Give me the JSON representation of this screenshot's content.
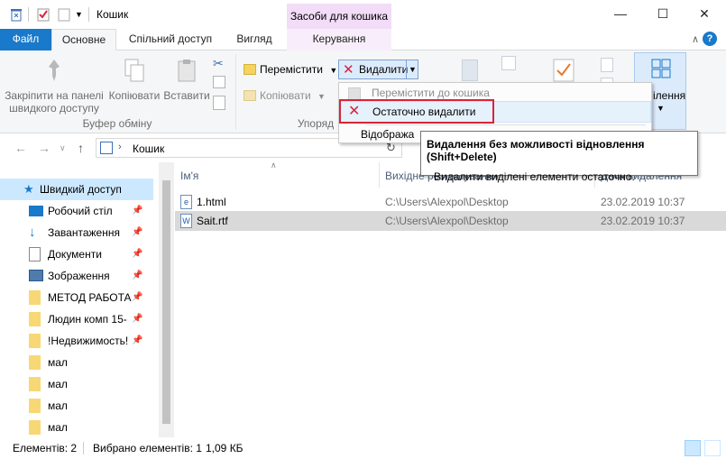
{
  "window": {
    "title": "Кошик",
    "context_tab_header": "Засоби для кошика",
    "minimize": "—",
    "maximize": "☐",
    "close": "✕"
  },
  "ribbon": {
    "tabs": [
      "Файл",
      "Основне",
      "Спільний доступ",
      "Вигляд",
      "Керування"
    ],
    "clipboard": {
      "pin_label": "Закріпити на панелі швидкого доступу",
      "copy_label": "Копіювати",
      "paste_label": "Вставити",
      "group_label": "Буфер обміну"
    },
    "organize": {
      "move_label": "Перемістити",
      "copy_to_label": "Копіювати",
      "delete_label": "Видалити",
      "group_label": "Упоряд"
    },
    "select_label": "ілення"
  },
  "dropdown": {
    "items": [
      "Перемістити до кошика",
      "Остаточно видалити",
      "Відобража"
    ]
  },
  "tooltip": {
    "title": "Видалення без можливості відновлення (Shift+Delete)",
    "description": "Видалити виділені елементи остаточно."
  },
  "address": {
    "path": "Кошик"
  },
  "nav": {
    "items": [
      {
        "label": "Швидкий доступ",
        "icon": "star-icon"
      },
      {
        "label": "Робочий стіл",
        "icon": "desktop-icon"
      },
      {
        "label": "Завантаження",
        "icon": "download-icon"
      },
      {
        "label": "Документи",
        "icon": "documents-icon"
      },
      {
        "label": "Зображення",
        "icon": "pictures-icon"
      },
      {
        "label": "МЕТОД РАБОТА",
        "icon": "folder-icon"
      },
      {
        "label": "Людин комп 15-",
        "icon": "folder-icon"
      },
      {
        "label": "!Недвижимость!",
        "icon": "folder-icon"
      },
      {
        "label": "мал",
        "icon": "folder-icon"
      },
      {
        "label": "мал",
        "icon": "folder-icon"
      },
      {
        "label": "мал",
        "icon": "folder-icon"
      },
      {
        "label": "мал",
        "icon": "folder-icon"
      }
    ]
  },
  "filelist": {
    "columns": [
      "Ім'я",
      "Вихідне розташування",
      "Дата видалення"
    ],
    "rows": [
      {
        "name": "1.html",
        "location": "C:\\Users\\Alexpol\\Desktop",
        "date": "23.02.2019 10:37"
      },
      {
        "name": "Sait.rtf",
        "location": "C:\\Users\\Alexpol\\Desktop",
        "date": "23.02.2019 10:37"
      }
    ]
  },
  "status": {
    "items_count": "Елементів: 2",
    "selected": "Вибрано елементів: 1",
    "size": "1,09 КБ"
  },
  "colors": {
    "accent": "#1979ca",
    "highlight_red": "#d9243a",
    "selection": "#cce8ff",
    "context_tab": "#f2dcf7"
  }
}
